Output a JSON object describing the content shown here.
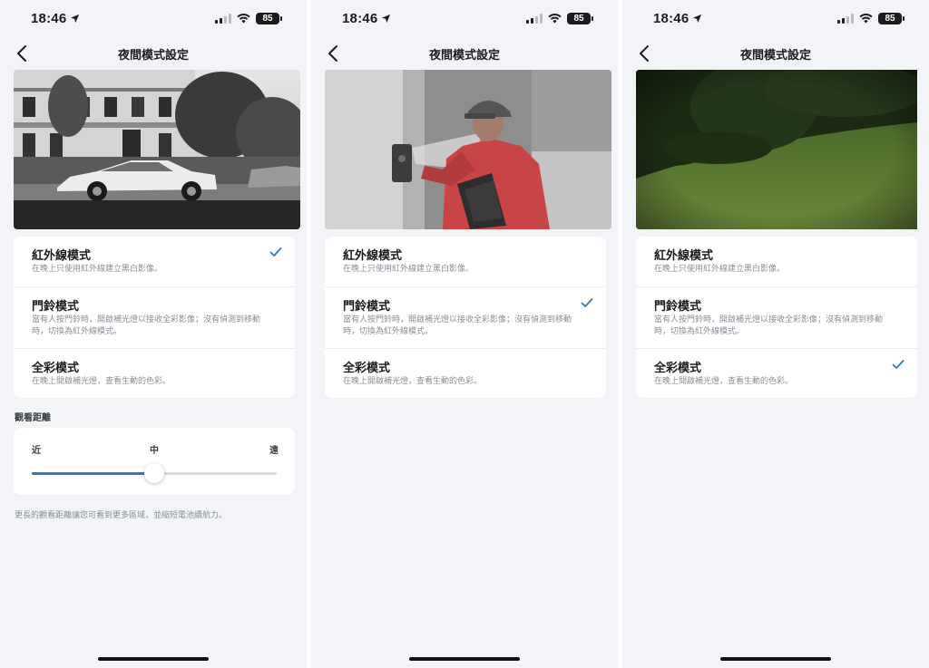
{
  "status": {
    "time": "18:46",
    "battery": "85"
  },
  "nav": {
    "title": "夜間模式設定"
  },
  "modes": [
    {
      "name": "紅外線模式",
      "desc": "在晚上只使用紅外線建立黑白影像。"
    },
    {
      "name": "門鈴模式",
      "desc": "當有人按門鈴時，開啟補光燈以接收全彩影像；沒有偵測到移動時，切換為紅外線模式。"
    },
    {
      "name": "全彩模式",
      "desc": "在晚上開啟補光燈，查看生動的色彩。"
    }
  ],
  "screens": [
    {
      "selected_mode": 0,
      "preview": "infrared-street-preview"
    },
    {
      "selected_mode": 1,
      "preview": "doorbell-visitor-preview"
    },
    {
      "selected_mode": 2,
      "preview": "fullcolor-lawn-preview"
    }
  ],
  "distance": {
    "section_label": "觀看距離",
    "labels": {
      "near": "近",
      "mid": "中",
      "far": "遠"
    },
    "value_fraction": 0.5,
    "hint": "更長的觀看距離讓您可看到更多區域，並縮短電池續航力。"
  },
  "colors": {
    "accent": "#2f7bbd",
    "background": "#f2f4f7",
    "card": "#ffffff"
  }
}
